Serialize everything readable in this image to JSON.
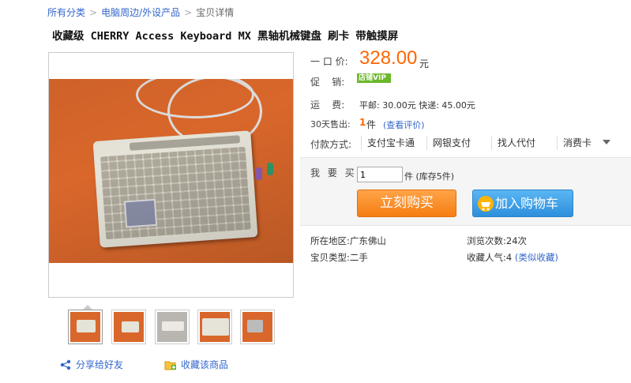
{
  "breadcrumb": {
    "items": [
      "所有分类",
      "电脑周边/外设产品"
    ],
    "current": "宝贝详情",
    "separator": ">"
  },
  "product": {
    "title": "收藏级 CHERRY Access Keyboard MX 黑轴机械键盘 刷卡 带触摸屏"
  },
  "gallery": {
    "thumbnail_count": 5,
    "share_label": "分享给好友",
    "favorite_label": "收藏该商品"
  },
  "price": {
    "label": "一 口 价:",
    "value": "328.00",
    "unit": "元"
  },
  "promo": {
    "label": "促    销:",
    "badge": "店铺VIP"
  },
  "shipping": {
    "label": "运    费:",
    "text": "平邮: 30.00元 快递: 45.00元"
  },
  "sales": {
    "label": "30天售出:",
    "count": "1",
    "unit": "件",
    "review_link": "(查看评价)"
  },
  "payment": {
    "label": "付款方式:",
    "options": [
      "支付宝卡通",
      "网银支付",
      "找人代付",
      "消费卡"
    ]
  },
  "purchase": {
    "qty_label": "我 要 买:",
    "qty_value": "1",
    "qty_unit": "件",
    "stock": "(库存5件)",
    "buy_now": "立刻购买",
    "add_to_cart": "加入购物车"
  },
  "details": {
    "location_label": "所在地区:",
    "location": "广东佛山",
    "type_label": "宝贝类型:",
    "type": "二手",
    "views_label": "浏览次数:",
    "views": "24次",
    "fav_label": "收藏人气:",
    "fav_count": "4",
    "similar_link": "(类似收藏)"
  },
  "colors": {
    "price": "#ff6600",
    "link": "#3366cc",
    "buy_button": "#f57d12",
    "cart_button": "#2e8fdc",
    "vip_badge": "#6bb82a"
  }
}
